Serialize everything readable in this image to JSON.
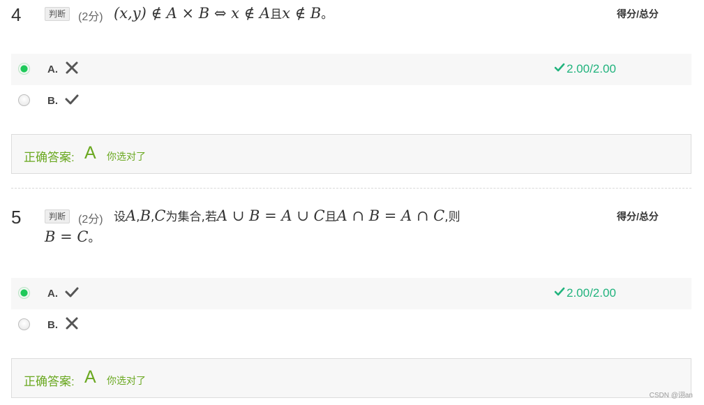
{
  "score_header_label": "得分/总分",
  "questions": [
    {
      "number": "4",
      "type_tag": "判断",
      "points": "(2分)",
      "stem": {
        "p1": "(x,y) ∉ A × B ⇔ x ∉ A",
        "c1": "且",
        "p2": "x ∉ B",
        "c2": "。"
      },
      "options": [
        {
          "letter": "A.",
          "icon": "cross-icon",
          "selected": true,
          "score": "2.00/2.00"
        },
        {
          "letter": "B.",
          "icon": "check-icon",
          "selected": false,
          "score": ""
        }
      ],
      "correct_answer_label": "正确答案:",
      "correct_answer_value": "A",
      "result_note": "你选对了"
    },
    {
      "number": "5",
      "type_tag": "判断",
      "points": "(2分)",
      "stem": {
        "c0": "设",
        "m1": "A",
        "c1": ",",
        "m2": "B",
        "c2": ",",
        "m3": "C",
        "c3": "为集合,若",
        "m4": "A ∪ B = A ∪ C",
        "c4": "且",
        "m5": "A ∩ B = A ∩ C",
        "c5": ",则",
        "m6": "B = C",
        "c6": "。"
      },
      "options": [
        {
          "letter": "A.",
          "icon": "check-icon",
          "selected": true,
          "score": "2.00/2.00"
        },
        {
          "letter": "B.",
          "icon": "cross-icon",
          "selected": false,
          "score": ""
        }
      ],
      "correct_answer_label": "正确答案:",
      "correct_answer_value": "A",
      "result_note": "你选对了"
    }
  ],
  "colors": {
    "selected_radio": "#1ec95a",
    "score_green": "#21b37d",
    "answer_green": "#6aa820",
    "option_bg": "#f7f7f7"
  },
  "watermark": "CSDN @诩an"
}
